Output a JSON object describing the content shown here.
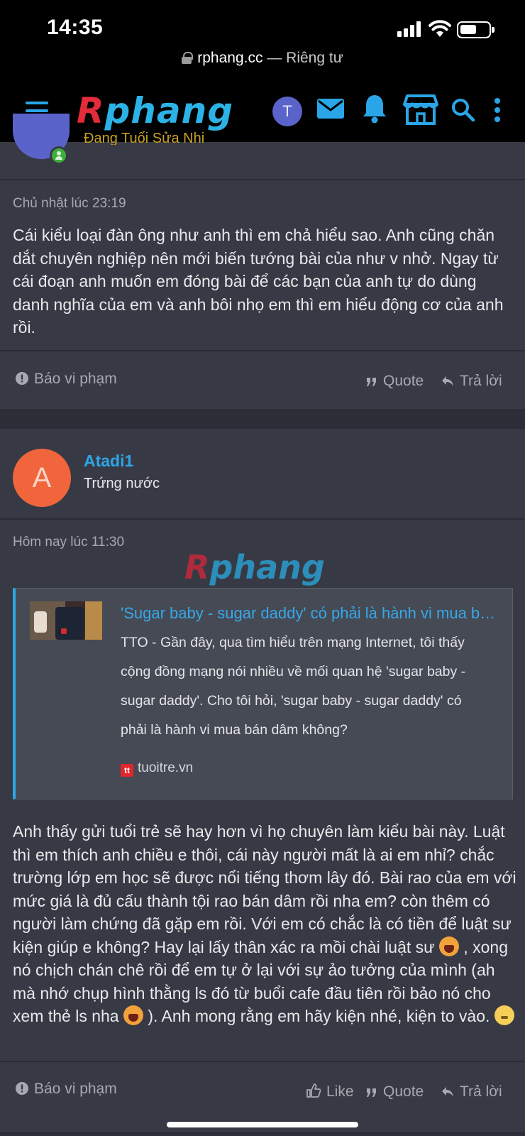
{
  "status_bar": {
    "time": "14:35"
  },
  "browser": {
    "domain": "rphang.cc",
    "privacy": " — Riêng tư"
  },
  "header": {
    "logo_first": "R",
    "logo_rest": "phang",
    "user_initial": "T"
  },
  "prev_post": {
    "user_title_partial": "Đang Tuổi Sửa Nhi",
    "timestamp": "Chủ nhật lúc 23:19",
    "body": "Cái kiểu loại đàn ông như anh thì em chả hiểu sao. Anh cũng chăn dắt chuyên nghiệp nên mới biến tướng bài của như v nhở. Ngay từ cái đoạn anh muốn em đóng bài để các bạn của anh tự do dùng danh nghĩa của em và anh bôi nhọ em thì em hiểu động cơ của anh rồi.",
    "actions": {
      "report": "Báo vi phạm",
      "quote": "Quote",
      "reply": "Trả lời"
    }
  },
  "post": {
    "avatar_letter": "A",
    "username": "Atadi1",
    "user_title": "Trứng nước",
    "timestamp": "Hôm nay lúc 11:30",
    "watermark_first": "R",
    "watermark_rest": "phang",
    "embed": {
      "title": "'Sugar baby - sugar daddy' có phải là hành vi mua bán dâm không?",
      "description": "TTO - Gần đây, qua tìm hiểu trên mạng Internet, tôi thấy cộng đồng mạng nói nhiều về mối quan hệ 'sugar baby - sugar daddy'. Cho tôi hỏi, 'sugar baby - sugar daddy' có phải là hành vi mua bán dâm không?",
      "source_logo": "tt",
      "source": "tuoitre.vn"
    },
    "body_1": "Anh thấy gửi tuổi trẻ sẽ hay hơn vì họ chuyên làm kiểu bài này. Luật thì em thích anh chiều e thôi, cái này người mất là ai em nhỉ? chắc trường lớp em học sẽ được nổi tiếng thơm lây đó. Bài rao của em với mức giá là đủ cấu thành tội rao bán dâm rồi nha em? còn thêm có người làm chứng đã gặp em rồi. Với em có chắc là có tiền để luật sư kiện giúp e không? Hay lại lấy thân xác ra mồi chài luật sư ",
    "body_2": " , xong nó chịch chán chê rồi để em tự ở lại với sự ảo tưởng của mình (ah mà nhớ chụp hình thằng ls đó từ buổi cafe đầu tiên rồi bảo nó cho xem thẻ ls nha ",
    "body_3": " ). Anh mong rằng em hãy kiện nhé, kiện to vào. ",
    "actions": {
      "report": "Báo vi phạm",
      "like": "Like",
      "quote": "Quote",
      "reply": "Trả lời"
    }
  },
  "colors": {
    "accent": "#2ea6e6",
    "background": "#2b2e36",
    "panel": "#373a44",
    "avatar_a": "#f0653b"
  }
}
